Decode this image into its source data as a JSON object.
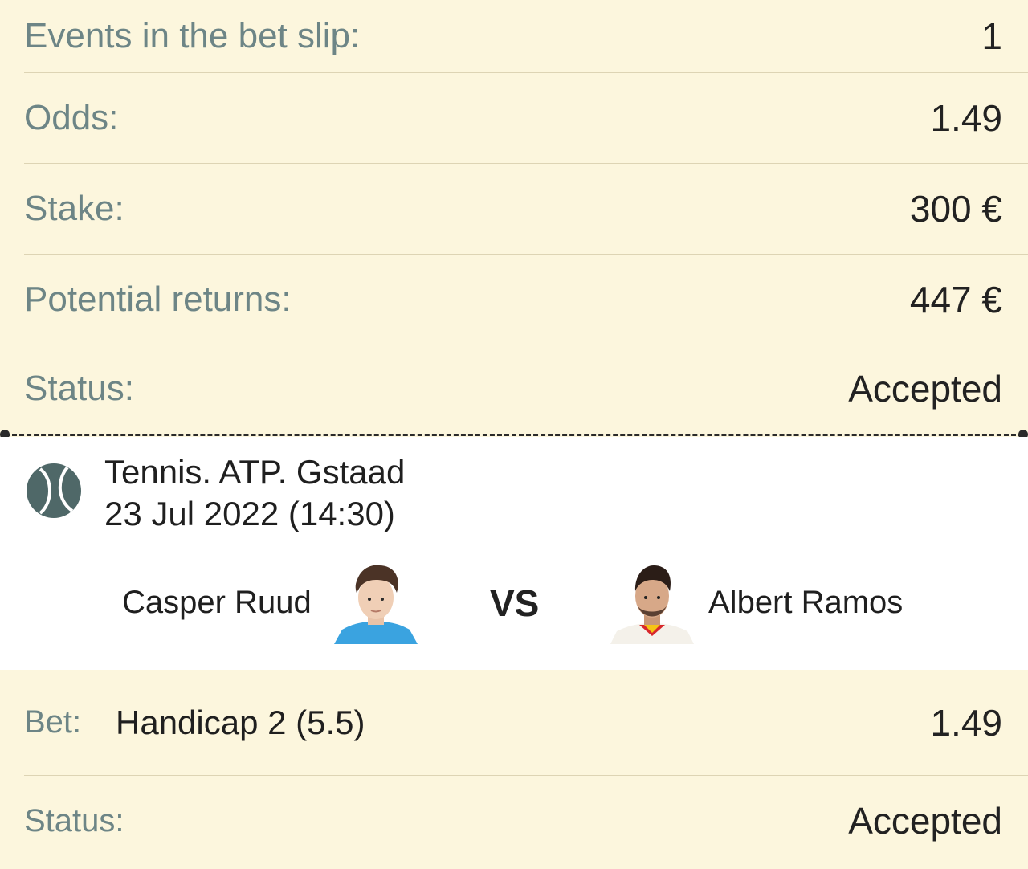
{
  "summary": {
    "events_label": "Events in the bet slip:",
    "events_value": "1",
    "odds_label": "Odds:",
    "odds_value": "1.49",
    "stake_label": "Stake:",
    "stake_value": "300 €",
    "returns_label": "Potential returns:",
    "returns_value": "447 €",
    "status_label": "Status:",
    "status_value": "Accepted"
  },
  "event": {
    "sport_icon": "tennis-ball-icon",
    "title": "Tennis. ATP. Gstaad",
    "datetime": "23 Jul 2022 (14:30)",
    "player1": "Casper Ruud",
    "vs": "VS",
    "player2": "Albert Ramos"
  },
  "bet": {
    "bet_label": "Bet:",
    "bet_value": "Handicap 2 (5.5)",
    "bet_odds": "1.49",
    "status_label": "Status:",
    "status_value": "Accepted"
  },
  "colors": {
    "background": "#fcf6dd",
    "label": "#6d8586",
    "card": "#ffffff"
  }
}
